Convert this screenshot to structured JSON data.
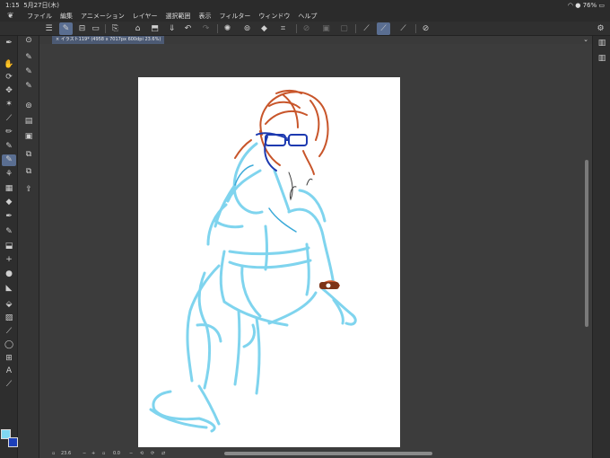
{
  "status_bar": {
    "time": "1:15",
    "date": "5月27日(木)",
    "battery": "76%"
  },
  "menu": [
    "ファイル",
    "編集",
    "アニメーション",
    "レイヤー",
    "選択範囲",
    "表示",
    "フィルター",
    "ウィンドウ",
    "ヘルプ"
  ],
  "document_tab": {
    "title": "イラスト119* (4958 x 7017px 600dpi 23.6%)"
  },
  "canvas": {
    "paper_color": "#ffffff"
  },
  "colors": {
    "main": "#7fd7f1",
    "sub": "#1c3fb8",
    "accent": "#5a6e91"
  },
  "navigator": {
    "zoom": "23.6",
    "angle": "0.0"
  },
  "toolbar_icons": [
    "menu-icon",
    "pen-active-icon",
    "snapshot-icon",
    "new-icon",
    "open-icon",
    "save-icon",
    "export-icon",
    "undo-icon",
    "redo-icon",
    "lasso-icon",
    "select-icon",
    "fill-icon",
    "transform-icon",
    "deselect-icon",
    "invert-icon",
    "clear-icon",
    "ruler-icon",
    "pen-icon",
    "brush-icon",
    "tablet-icon"
  ],
  "tools": [
    "eyedropper-icon",
    "hand-icon",
    "rotate-icon",
    "move-icon",
    "wand-icon",
    "eyedropper2-icon",
    "pencil-icon",
    "pen-icon",
    "brush-icon",
    "airbrush-icon",
    "decoration-icon",
    "eraser-icon",
    "blend-icon",
    "fill-icon",
    "shape-icon",
    "gradient-icon",
    "frame-icon",
    "ruler-icon",
    "text-icon",
    "lasso-icon",
    "correct-icon"
  ]
}
